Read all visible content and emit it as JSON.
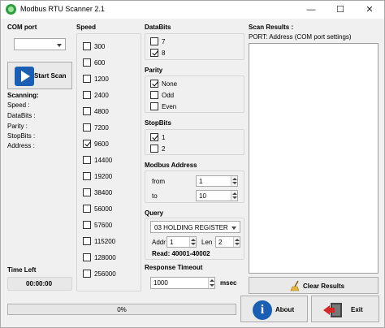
{
  "window": {
    "title": "Modbus RTU Scanner 2.1",
    "min_glyph": "—",
    "max_glyph": "☐",
    "close_glyph": "✕"
  },
  "com_port": {
    "label": "COM port",
    "value": ""
  },
  "start_scan": {
    "label": "Start Scan"
  },
  "scanning": {
    "heading": "Scanning:",
    "speed_label": "Speed :",
    "databits_label": "DataBits :",
    "parity_label": "Parity :",
    "stopbits_label": "StopBits :",
    "address_label": "Address :"
  },
  "time_left": {
    "label": "Time Left",
    "value": "00:00:00"
  },
  "speed": {
    "label": "Speed",
    "options": [
      {
        "value": "300",
        "checked": false
      },
      {
        "value": "600",
        "checked": false
      },
      {
        "value": "1200",
        "checked": false
      },
      {
        "value": "2400",
        "checked": false
      },
      {
        "value": "4800",
        "checked": false
      },
      {
        "value": "7200",
        "checked": false
      },
      {
        "value": "9600",
        "checked": true
      },
      {
        "value": "14400",
        "checked": false
      },
      {
        "value": "19200",
        "checked": false
      },
      {
        "value": "38400",
        "checked": false
      },
      {
        "value": "56000",
        "checked": false
      },
      {
        "value": "57600",
        "checked": false
      },
      {
        "value": "115200",
        "checked": false
      },
      {
        "value": "128000",
        "checked": false
      },
      {
        "value": "256000",
        "checked": false
      }
    ]
  },
  "databits": {
    "label": "DataBits",
    "options": [
      {
        "value": "7",
        "checked": false
      },
      {
        "value": "8",
        "checked": true
      }
    ]
  },
  "parity": {
    "label": "Parity",
    "options": [
      {
        "value": "None",
        "checked": true
      },
      {
        "value": "Odd",
        "checked": false
      },
      {
        "value": "Even",
        "checked": false
      }
    ]
  },
  "stopbits": {
    "label": "StopBits",
    "options": [
      {
        "value": "1",
        "checked": true
      },
      {
        "value": "2",
        "checked": false
      }
    ]
  },
  "modbus_address": {
    "label": "Modbus Address",
    "from_label": "from",
    "from_value": "1",
    "to_label": "to",
    "to_value": "10"
  },
  "query": {
    "label": "Query",
    "function": "03 HOLDING REGISTER",
    "addr_label": "Addr",
    "addr_value": "1",
    "len_label": "Len",
    "len_value": "2",
    "read_text": "Read: 40001-40002"
  },
  "response_timeout": {
    "label": "Response Timeout",
    "value": "1000",
    "unit": "msec"
  },
  "scan_results": {
    "label": "Scan Results :",
    "header": "PORT: Address (COM port settings)"
  },
  "clear_results": {
    "label": "Clear Results"
  },
  "about": {
    "label": "About"
  },
  "exit": {
    "label": "Exit"
  },
  "progress": {
    "text": "0%",
    "fraction": 0
  },
  "colors": {
    "accent": "#1a5fb4",
    "progress_fill": "#06b025"
  }
}
